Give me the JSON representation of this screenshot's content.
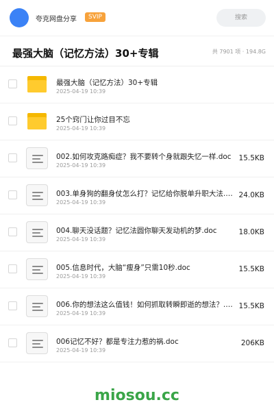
{
  "topbar": {
    "share_title": "夸克网盘分享",
    "badge": "SVIP",
    "search_placeholder": "搜索",
    "avatar_color": "#3b82f6"
  },
  "folder": {
    "title": "最强大脑（记忆方法）30+专辑",
    "stats": "共 7901 项 · 194.8G"
  },
  "files": [
    {
      "type": "folder",
      "name": "最强大脑（记忆方法）30+专辑",
      "date": "2025-04-19 10:39",
      "size": ""
    },
    {
      "type": "folder",
      "name": "25个窍门让你过目不忘",
      "date": "2025-04-19 10:39",
      "size": ""
    },
    {
      "type": "doc",
      "name": "002.如何攻克路痴症？我不要转个身就跟失忆一样.doc",
      "date": "2025-04-19 10:39",
      "size": "15.5KB"
    },
    {
      "type": "doc",
      "name": "003.单身狗的翻身仗怎么打？记忆给你脱单升职大法.doc",
      "date": "2025-04-19 10:39",
      "size": "24.0KB"
    },
    {
      "type": "doc",
      "name": "004.聊天没话题？记忆法圆你聊天发动机的梦.doc",
      "date": "2025-04-19 10:39",
      "size": "18.0KB"
    },
    {
      "type": "doc",
      "name": "005.信息时代，大脑“瘦身”只需10秒.doc",
      "date": "2025-04-19 10:39",
      "size": "15.5KB"
    },
    {
      "type": "doc",
      "name": "006.你的想法这么值钱！如何抓取转瞬即逝的想法？.doc",
      "date": "2025-04-19 10:39",
      "size": "15.5KB"
    },
    {
      "type": "doc",
      "name": "006记忆不好？都是专注力惹的祸.doc",
      "date": "2025-04-19 10:39",
      "size": "206KB"
    }
  ],
  "watermark": "miosou.cc"
}
